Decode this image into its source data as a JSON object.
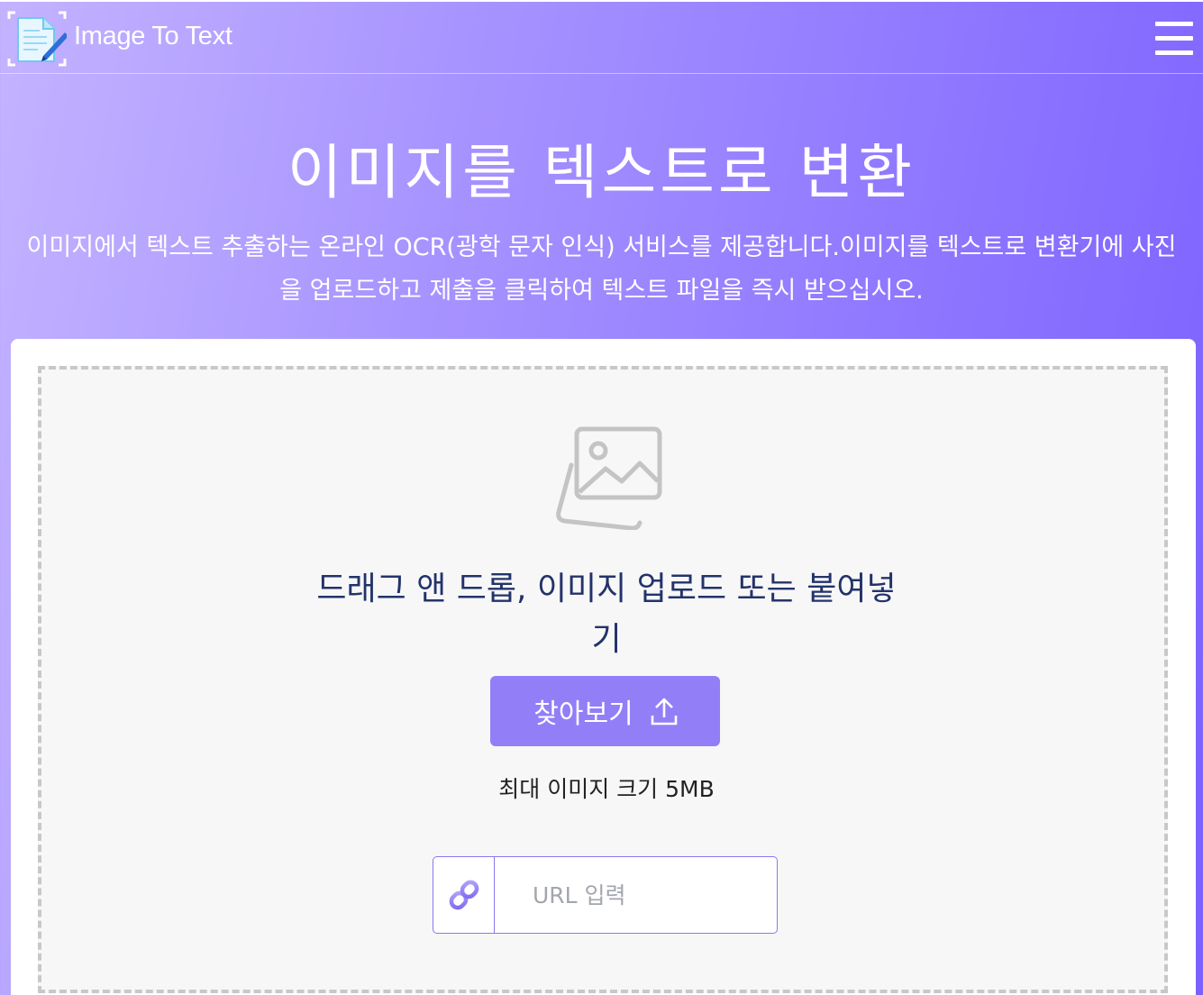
{
  "header": {
    "brand": "Image To Text",
    "logo_icon": "document-pen-logo-icon",
    "menu_icon": "hamburger-menu-icon"
  },
  "hero": {
    "title": "이미지를 텍스트로 변환",
    "description": "이미지에서 텍스트 추출하는 온라인 OCR(광학 문자 인식) 서비스를 제공합니다.이미지를 텍스트로 변환기에 사진을 업로드하고 제출을 클릭하여 텍스트 파일을 즉시 받으십시오."
  },
  "upload": {
    "image_icon": "image-placeholder-icon",
    "drop_text": "드래그 앤 드롭, 이미지 업로드 또는 붙여넣기",
    "browse_label": "찾아보기",
    "browse_icon": "upload-arrow-icon",
    "max_size": "최대 이미지 크기 5MB",
    "url_icon": "link-icon",
    "url_placeholder": "URL 입력",
    "url_value": ""
  },
  "colors": {
    "accent": "#927ff7",
    "gradient_start": "#c3b3ff",
    "gradient_end": "#7c60ff",
    "drop_text": "#23336a"
  }
}
